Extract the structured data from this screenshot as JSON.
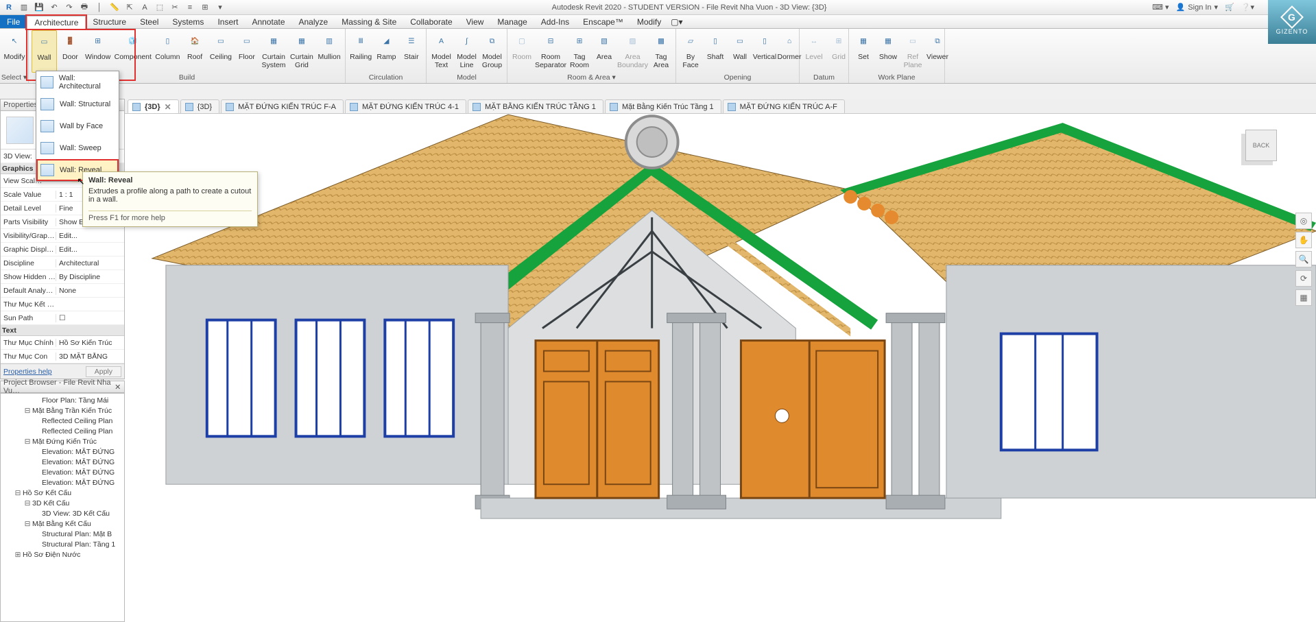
{
  "app": {
    "title": "Autodesk Revit 2020 - STUDENT VERSION - File Revit Nha Vuon - 3D View: {3D}",
    "signin": "Sign In"
  },
  "brand": "GIZENTO",
  "tabs": {
    "file": "File",
    "items": [
      "Architecture",
      "Structure",
      "Steel",
      "Systems",
      "Insert",
      "Annotate",
      "Analyze",
      "Massing & Site",
      "Collaborate",
      "View",
      "Manage",
      "Add-Ins",
      "Enscape™",
      "Modify"
    ],
    "active": "Architecture"
  },
  "ribbon": {
    "select": {
      "modify": "Modify",
      "group": "Select ▾"
    },
    "build": {
      "wall": "Wall",
      "door": "Door",
      "window": "Window",
      "component": "Component",
      "column": "Column",
      "roof": "Roof",
      "ceiling": "Ceiling",
      "floor": "Floor",
      "curtain_system": "Curtain\nSystem",
      "curtain_grid": "Curtain\nGrid",
      "mullion": "Mullion",
      "label": "Build"
    },
    "circulation": {
      "railing": "Railing",
      "ramp": "Ramp",
      "stair": "Stair",
      "label": "Circulation"
    },
    "model": {
      "text": "Model\nText",
      "line": "Model\nLine",
      "group": "Model\nGroup",
      "label": "Model"
    },
    "roomarea": {
      "room": "Room",
      "sep": "Room\nSeparator",
      "tagroom": "Tag\nRoom",
      "area": "Area",
      "boundary": "Area\nBoundary",
      "tagarea": "Tag\nArea",
      "label": "Room & Area ▾"
    },
    "opening": {
      "byface": "By\nFace",
      "shaft": "Shaft",
      "wall": "Wall",
      "vertical": "Vertical",
      "dormer": "Dormer",
      "label": "Opening"
    },
    "datum": {
      "level": "Level",
      "grid": "Grid",
      "label": "Datum"
    },
    "workplane": {
      "set": "Set",
      "show": "Show",
      "ref": "Ref\nPlane",
      "viewer": "Viewer",
      "label": "Work Plane"
    }
  },
  "wall_dropdown": {
    "items": [
      "Wall: Architectural",
      "Wall: Structural",
      "Wall by Face",
      "Wall: Sweep",
      "Wall: Reveal"
    ],
    "hover_index": 4
  },
  "tooltip": {
    "title": "Wall: Reveal",
    "desc": "Extrudes a profile along a path to create a cutout in a wall.",
    "help": "Press F1 for more help"
  },
  "doctabs": [
    {
      "label": "{3D}",
      "active": true,
      "closeable": true
    },
    {
      "label": "{3D}"
    },
    {
      "label": "MẶT ĐỨNG KIẾN TRÚC F-A"
    },
    {
      "label": "MẶT ĐỨNG KIẾN TRÚC 4-1"
    },
    {
      "label": "MẶT BẰNG KIẾN TRÚC TẦNG 1"
    },
    {
      "label": "Mặt Bằng Kiến Trúc Tầng 1"
    },
    {
      "label": "MẶT ĐỨNG KIẾN TRÚC A-F"
    }
  ],
  "properties": {
    "title": "Properties",
    "view_type": "3D View:",
    "cat_graphics": "Graphics",
    "rows": [
      {
        "l": "View Scal…",
        "v": ""
      },
      {
        "l": "Scale Value",
        "v": "1 : 1"
      },
      {
        "l": "Detail Level",
        "v": "Fine"
      },
      {
        "l": "Parts Visibility",
        "v": "Show Bo…"
      },
      {
        "l": "Visibility/Grap…",
        "v": "Edit..."
      },
      {
        "l": "Graphic Displ…",
        "v": "Edit..."
      },
      {
        "l": "Discipline",
        "v": "Architectural"
      },
      {
        "l": "Show Hidden …",
        "v": "By Discipline"
      },
      {
        "l": "Default Analy…",
        "v": "None"
      },
      {
        "l": "Thư Mục Kết …",
        "v": ""
      },
      {
        "l": "Sun Path",
        "v": "☐"
      }
    ],
    "cat_text": "Text",
    "text_rows": [
      {
        "l": "Thư Mục Chính",
        "v": "Hồ Sơ Kiến Trúc"
      },
      {
        "l": "Thư Mục Con",
        "v": "3D MẶT BẰNG"
      }
    ],
    "foot_link": "Properties help",
    "foot_btn": "Apply"
  },
  "browser": {
    "title": "Project Browser - File Revit Nha Vu…",
    "nodes": [
      {
        "t": "Floor Plan: Tầng Mái",
        "i": 3,
        "w": ""
      },
      {
        "t": "Mặt Bằng Trần Kiến Trúc",
        "i": 2,
        "w": "⊟"
      },
      {
        "t": "Reflected Ceiling Plan",
        "i": 3,
        "w": ""
      },
      {
        "t": "Reflected Ceiling Plan",
        "i": 3,
        "w": ""
      },
      {
        "t": "Mặt Đứng Kiến Trúc",
        "i": 2,
        "w": "⊟"
      },
      {
        "t": "Elevation: MẶT ĐỨNG",
        "i": 3,
        "w": ""
      },
      {
        "t": "Elevation: MẶT ĐỨNG",
        "i": 3,
        "w": ""
      },
      {
        "t": "Elevation: MẶT ĐỨNG",
        "i": 3,
        "w": ""
      },
      {
        "t": "Elevation: MẶT ĐỨNG",
        "i": 3,
        "w": ""
      },
      {
        "t": "Hồ Sơ Kết Cấu",
        "i": 1,
        "w": "⊟"
      },
      {
        "t": "3D Kết Cấu",
        "i": 2,
        "w": "⊟"
      },
      {
        "t": "3D View: 3D Kết Cấu",
        "i": 3,
        "w": ""
      },
      {
        "t": "Mặt Bằng Kết Cấu",
        "i": 2,
        "w": "⊟"
      },
      {
        "t": "Structural Plan: Mặt B",
        "i": 3,
        "w": ""
      },
      {
        "t": "Structural Plan: Tầng 1",
        "i": 3,
        "w": ""
      },
      {
        "t": "Hồ Sơ Điện Nước",
        "i": 1,
        "w": "⊞"
      }
    ]
  },
  "viewcube": "BACK"
}
